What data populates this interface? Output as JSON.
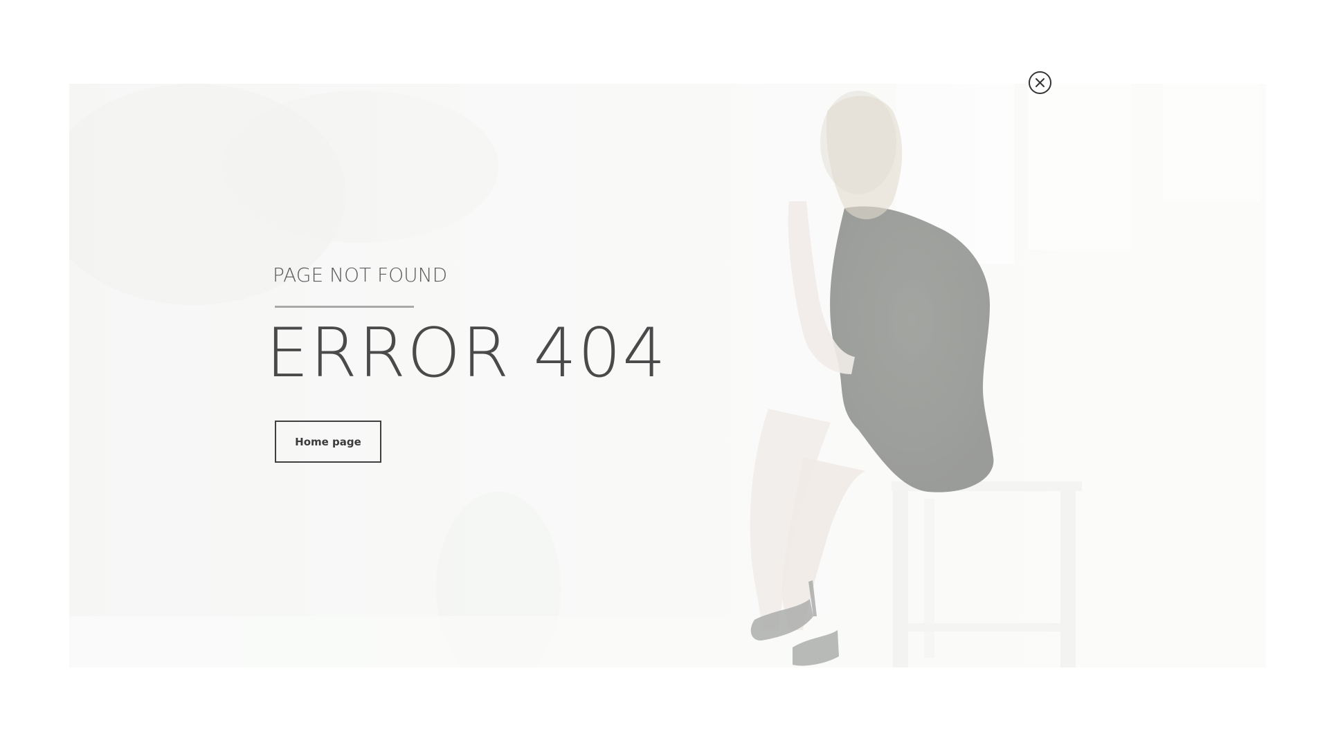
{
  "error_page": {
    "subtitle": "PAGE NOT FOUND",
    "title": "ERROR 404",
    "home_button_label": "Home page"
  },
  "close": {
    "icon": "close-icon"
  },
  "colors": {
    "text_dark": "#4a4a4a",
    "divider": "#a8aaa7",
    "button_border": "#3f3f3f"
  }
}
